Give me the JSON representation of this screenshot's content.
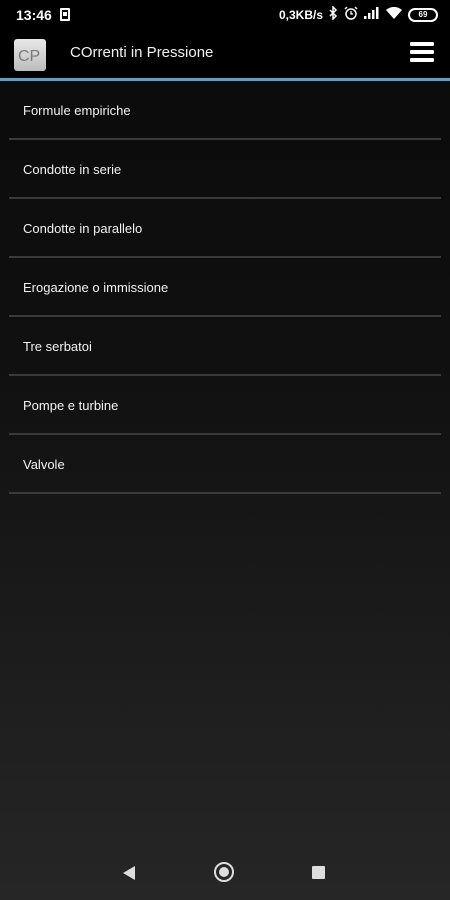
{
  "status_bar": {
    "time": "13:46",
    "network_speed": "0,3KB/s",
    "battery_level": "69"
  },
  "toolbar": {
    "logo_text": "CP",
    "title": "COrrenti in Pressione",
    "accent_color": "#5aa0cf"
  },
  "menu": {
    "items": [
      {
        "label": "Formule empiriche"
      },
      {
        "label": "Condotte in serie"
      },
      {
        "label": "Condotte in parallelo"
      },
      {
        "label": "Erogazione o immissione"
      },
      {
        "label": "Tre serbatoi"
      },
      {
        "label": "Pompe e turbine"
      },
      {
        "label": "Valvole"
      }
    ]
  },
  "icons": [
    "notification-icon",
    "bluetooth-icon",
    "alarm-icon",
    "signal-icon",
    "wifi-icon",
    "battery-icon",
    "menu-icon",
    "back-icon",
    "home-icon",
    "recents-icon"
  ]
}
